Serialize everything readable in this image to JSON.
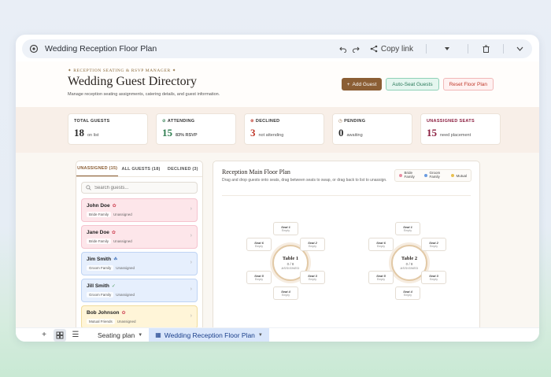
{
  "window": {
    "title": "Wedding Reception Floor Plan",
    "copy_link": "Copy link"
  },
  "hero": {
    "kicker": "Reception Seating & RSVP Manager",
    "title": "Wedding Guest Directory",
    "subtitle": "Manage reception seating assignments, catering details, and guest information.",
    "add_guest": "Add Guest",
    "auto_seat": "Auto-Seat Guests",
    "reset": "Reset Floor Plan"
  },
  "stats": [
    {
      "label": "TOTAL GUESTS",
      "value": "18",
      "sub": "on list",
      "color": "#2a2420"
    },
    {
      "label": "ATTENDING",
      "value": "15",
      "sub": "83% RSVP",
      "color": "#2e7d4f"
    },
    {
      "label": "DECLINED",
      "value": "3",
      "sub": "not attending",
      "color": "#c0392b"
    },
    {
      "label": "PENDING",
      "value": "0",
      "sub": "awaiting",
      "color": "#2a2420"
    },
    {
      "label": "UNASSIGNED SEATS",
      "value": "15",
      "sub": "need placement",
      "color": "#8b1e3f"
    }
  ],
  "sidebar": {
    "tabs": [
      "UNASSIGNED (15)",
      "ALL GUESTS (18)",
      "DECLINED (3)"
    ],
    "search_placeholder": "Search guests...",
    "guests": [
      {
        "name": "John Doe",
        "tag": "Bride Family",
        "status": "Unassigned",
        "group": "bride"
      },
      {
        "name": "Jane Doe",
        "tag": "Bride Family",
        "status": "Unassigned",
        "group": "bride"
      },
      {
        "name": "Jim Smith",
        "tag": "Groom Family",
        "status": "Unassigned",
        "group": "groom"
      },
      {
        "name": "Jill Smith",
        "tag": "Groom Family",
        "status": "Unassigned",
        "group": "groom"
      },
      {
        "name": "Bob Johnson",
        "tag": "Mutual Friends",
        "status": "Unassigned",
        "group": "mutual"
      }
    ]
  },
  "floor": {
    "title": "Reception Main Floor Plan",
    "desc": "Drag and drop guests onto seats, drag between seats to swap, or drag back to list to unassign.",
    "legend": [
      {
        "label": "Bride Family",
        "color": "#e88aa0"
      },
      {
        "label": "Groom Family",
        "color": "#6a9be0"
      },
      {
        "label": "Mutual",
        "color": "#e8c050"
      }
    ],
    "tables": [
      {
        "name": "Table 1",
        "count": "0 / 8",
        "sub": "ASSIGNED"
      },
      {
        "name": "Table 2",
        "count": "0 / 8",
        "sub": "ASSIGNED"
      }
    ],
    "seats": [
      {
        "name": "Seat 1",
        "status": "Empty"
      },
      {
        "name": "Seat 2",
        "status": "Empty"
      },
      {
        "name": "Seat 3",
        "status": "Empty"
      },
      {
        "name": "Seat 4",
        "status": "Empty"
      },
      {
        "name": "Seat 5",
        "status": "Empty"
      },
      {
        "name": "Seat 6",
        "status": "Empty"
      }
    ]
  },
  "bottombar": {
    "sheet1": "Seating plan",
    "sheet2": "Wedding Reception Floor Plan"
  }
}
